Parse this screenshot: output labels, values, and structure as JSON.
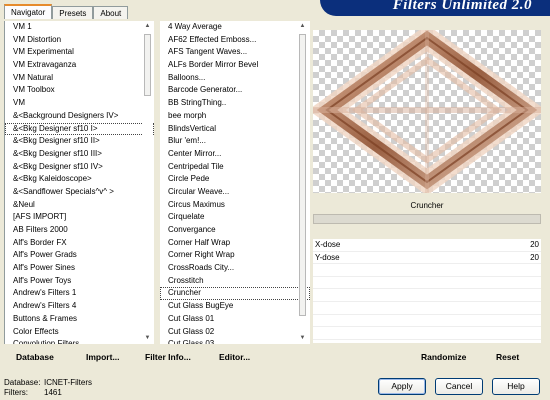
{
  "tabs": [
    "Navigator",
    "Presets",
    "About"
  ],
  "banner_title": "Filters Unlimited 2.0",
  "categories": [
    "VM 1",
    "VM Distortion",
    "VM Experimental",
    "VM Extravaganza",
    "VM Natural",
    "VM Toolbox",
    "VM",
    "&<Background Designers IV>",
    "&<Bkg Designer sf10 I>",
    "&<Bkg Designer sf10 II>",
    "&<Bkg Designer sf10 III>",
    "&<Bkg Designer sf10 IV>",
    "&<Bkg Kaleidoscope>",
    "&<Sandflower Specials^v^ >",
    "&Neul",
    "[AFS IMPORT]",
    "AB Filters 2000",
    "Alf's Border FX",
    "Alf's Power Grads",
    "Alf's Power Sines",
    "Alf's Power Toys",
    "Andrew's Filters 1",
    "Andrew's Filters 4",
    "Buttons & Frames",
    "Color Effects",
    "Convolution Filters"
  ],
  "selected_category_index": 8,
  "filters": [
    "4 Way Average",
    "AF62 Effected Emboss...",
    "AFS Tangent Waves...",
    "ALFs Border Mirror Bevel",
    "Balloons...",
    "Barcode Generator...",
    "BB StringThing..",
    "bee morph",
    "BlindsVertical",
    "Blur 'em!...",
    "Center Mirror...",
    "Centripedal Tile",
    "Circle Pede",
    "Circular Weave...",
    "Circus Maximus",
    "Cirquelate",
    "Convergance",
    "Corner Half Wrap",
    "Corner Right Wrap",
    "CrossRoads City...",
    "Crosstitch",
    "Cruncher",
    "Cut Glass  BugEye",
    "Cut Glass 01",
    "Cut Glass 02",
    "Cut Glass 03"
  ],
  "selected_filter_index": 21,
  "filter_name": "Cruncher",
  "params": [
    {
      "label": "X-dose",
      "value": "20"
    },
    {
      "label": "Y-dose",
      "value": "20"
    }
  ],
  "left_buttons": {
    "database": "Database",
    "import": "Import...",
    "filter_info": "Filter Info...",
    "editor": "Editor..."
  },
  "right_buttons": {
    "randomize": "Randomize",
    "reset": "Reset"
  },
  "info": {
    "database_label": "Database:",
    "database_value": "ICNET-Filters",
    "filters_label": "Filters:",
    "filters_value": "1461"
  },
  "dialog_buttons": {
    "apply": "Apply",
    "cancel": "Cancel",
    "help": "Help"
  },
  "colors": {
    "banner": "#0b2f7c",
    "tab_accent": "#e68b2c",
    "preview_stroke": "#b06a3f"
  }
}
